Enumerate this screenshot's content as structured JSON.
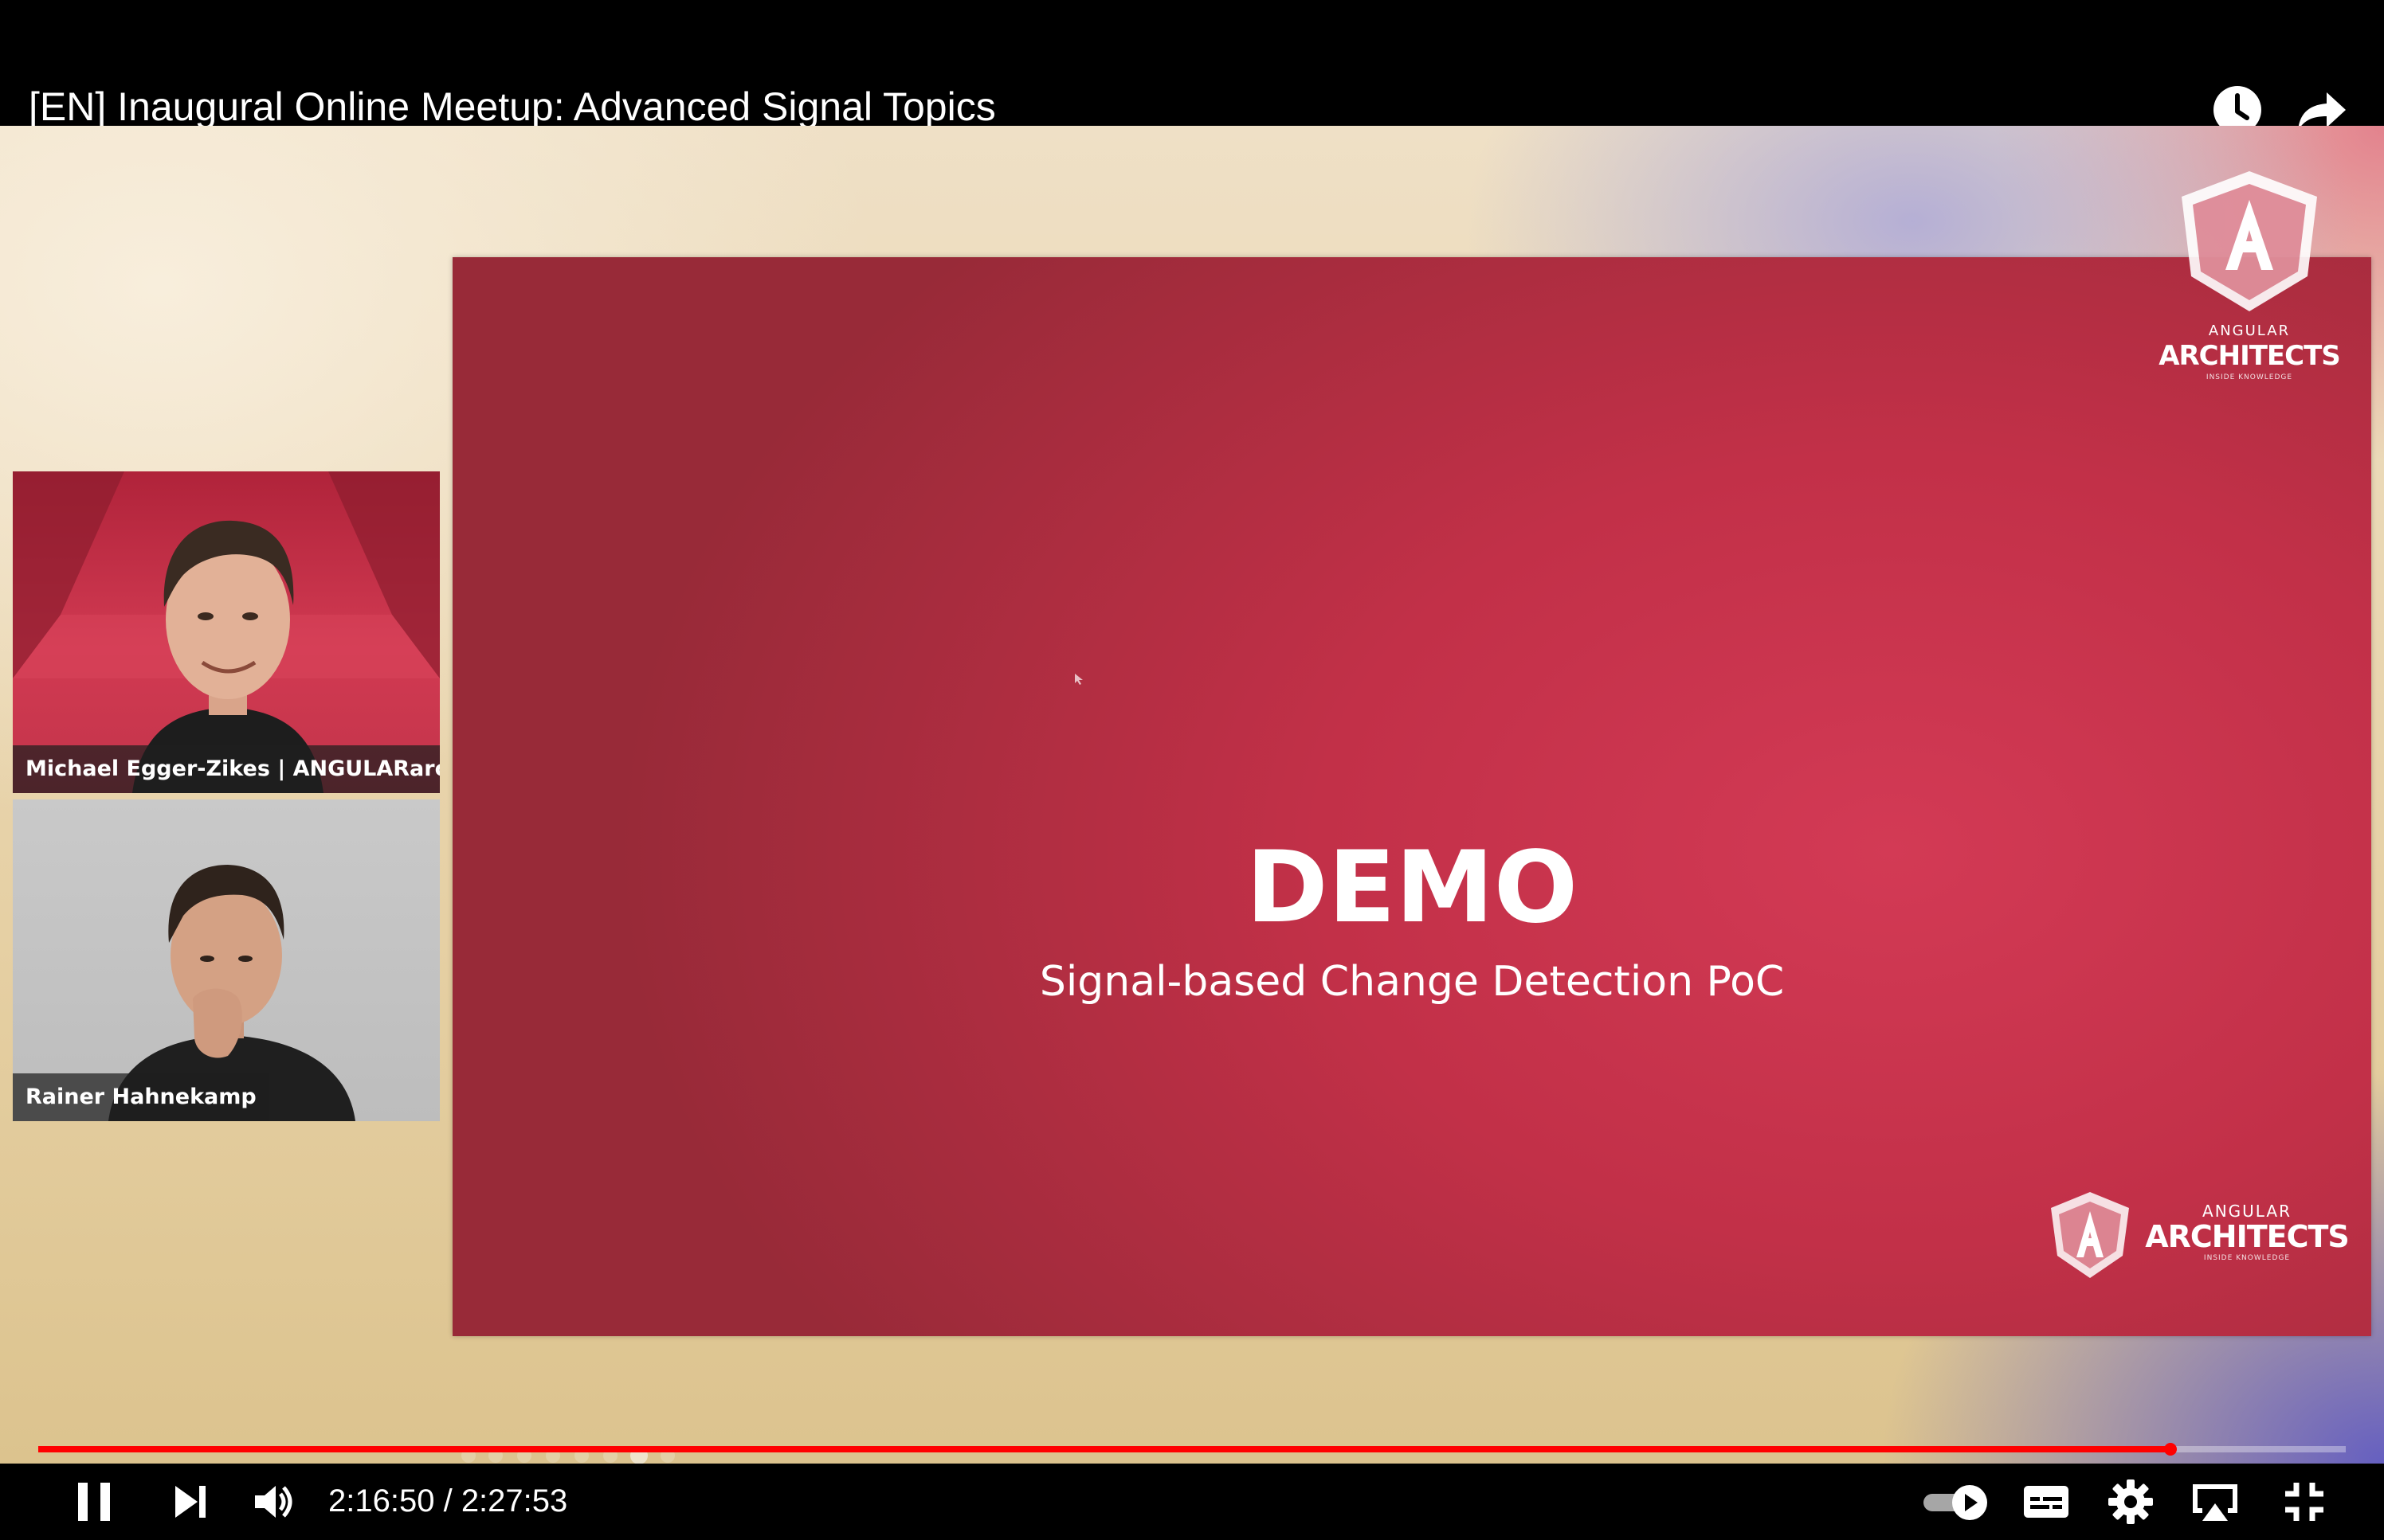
{
  "video": {
    "title": "[EN] Inaugural Online Meetup: Advanced Signal Topics",
    "time_current": "2:16:50",
    "time_separator": " / ",
    "time_total": "2:27:53",
    "progress_fraction": 0.924
  },
  "top_icons": [
    "watch-later-icon",
    "share-icon"
  ],
  "slide": {
    "heading": "DEMO",
    "subheading": "Signal-based Change Detection PoC",
    "logo_top": {
      "small": "ANGULAR",
      "big": "ARCHITECTS",
      "tag": "INSIDE KNOWLEDGE"
    },
    "logo_bottom": {
      "small": "ANGULAR",
      "big": "ARCHITECTS",
      "tag": "INSIDE KNOWLEDGE"
    }
  },
  "participants": [
    {
      "name": "Michael Egger-Zikes | ANGULARarc..."
    },
    {
      "name": "Rainer Hahnekamp"
    }
  ],
  "controls": {
    "left": [
      "pause-icon",
      "next-icon",
      "volume-icon"
    ],
    "right": [
      "autoplay-toggle-icon",
      "subtitles-icon",
      "settings-icon",
      "airplay-icon",
      "exit-fullscreen-icon"
    ]
  },
  "colors": {
    "progress": "#ff0000",
    "slide_red": "#c23048",
    "bar_background": "#000000"
  }
}
